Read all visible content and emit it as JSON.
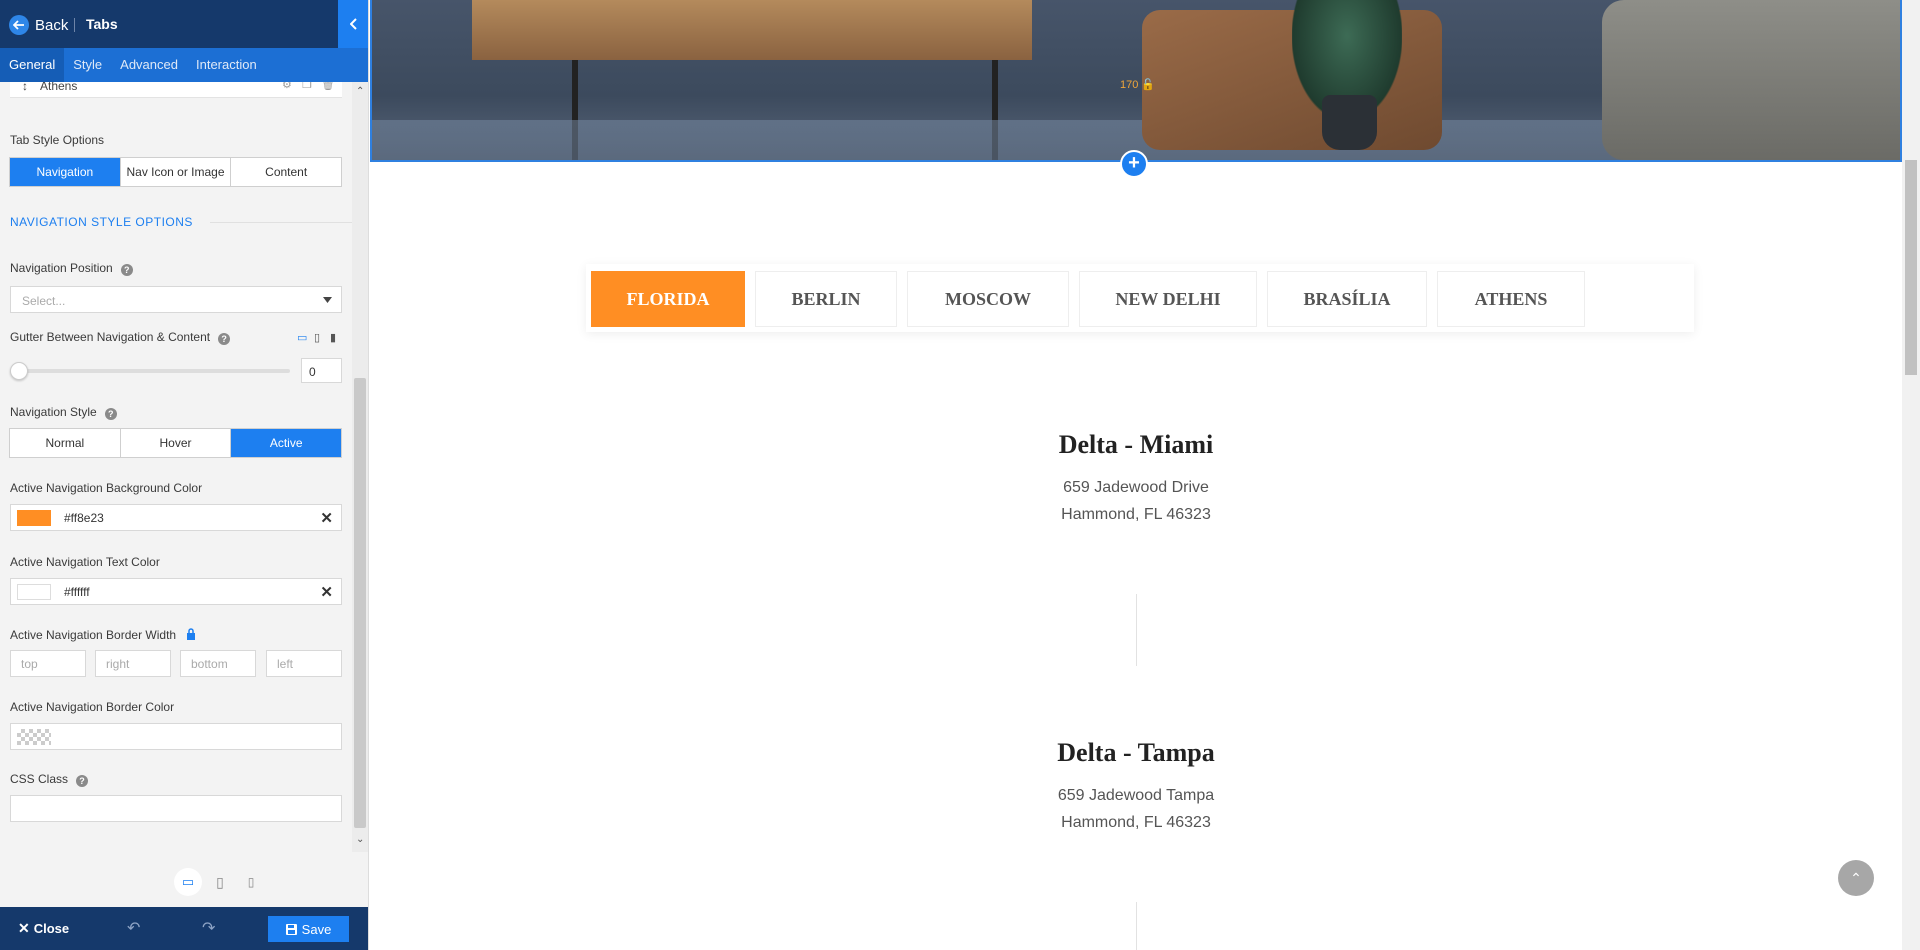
{
  "sidebar": {
    "header": {
      "back_label": "Back",
      "title": "Tabs"
    },
    "tabs": [
      {
        "label": "General"
      },
      {
        "label": "Style"
      },
      {
        "label": "Advanced"
      },
      {
        "label": "Interaction"
      }
    ],
    "item_row": {
      "label": "Athens"
    },
    "tab_style_options": {
      "label": "Tab Style Options",
      "options": [
        "Navigation",
        "Nav Icon or Image",
        "Content"
      ],
      "selected": "Navigation"
    },
    "section_heading": "NAVIGATION STYLE OPTIONS",
    "navigation_position": {
      "label": "Navigation Position",
      "placeholder": "Select..."
    },
    "gutter": {
      "label": "Gutter Between Navigation & Content",
      "value": "0"
    },
    "navigation_style": {
      "label": "Navigation Style",
      "options": [
        "Normal",
        "Hover",
        "Active"
      ],
      "selected": "Active"
    },
    "active_bg_color": {
      "label": "Active Navigation Background Color",
      "value": "#ff8e23",
      "swatch": "#ff8e23"
    },
    "active_text_color": {
      "label": "Active Navigation Text Color",
      "value": "#ffffff",
      "swatch": "#ffffff"
    },
    "active_border_width": {
      "label": "Active Navigation Border Width",
      "placeholders": {
        "top": "top",
        "right": "right",
        "bottom": "bottom",
        "left": "left"
      }
    },
    "active_border_color": {
      "label": "Active Navigation Border Color"
    },
    "css_class": {
      "label": "CSS Class"
    },
    "footer": {
      "close_label": "Close",
      "save_label": "Save"
    }
  },
  "canvas": {
    "hero_badge": "170",
    "city_tabs": [
      {
        "label": "FLORIDA",
        "active": true
      },
      {
        "label": "BERLIN"
      },
      {
        "label": "MOSCOW"
      },
      {
        "label": "NEW DELHI"
      },
      {
        "label": "BRASÍLIA"
      },
      {
        "label": "ATHENS"
      }
    ],
    "locations": [
      {
        "title": "Delta - Miami",
        "line1": "659 Jadewood Drive",
        "line2": "Hammond, FL 46323"
      },
      {
        "title": "Delta - Tampa",
        "line1": "659 Jadewood Tampa",
        "line2": "Hammond, FL 46323"
      }
    ]
  },
  "colors": {
    "accent": "#1d7ff0",
    "header": "#15396b",
    "active_tab": "#ff8e23"
  }
}
